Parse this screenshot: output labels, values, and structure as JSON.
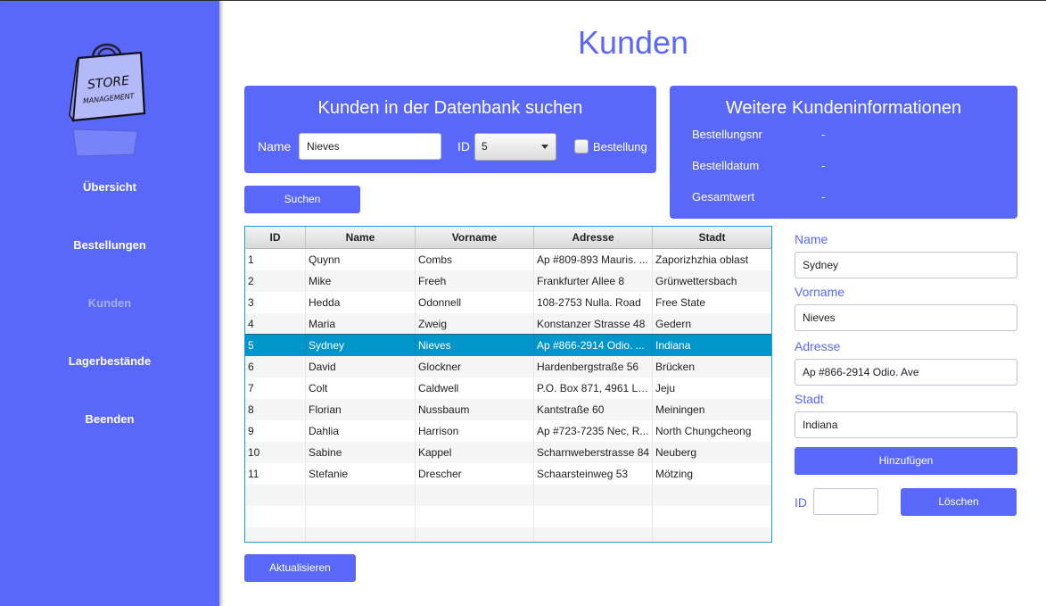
{
  "sidebar": {
    "logo_text_line1": "STORE",
    "logo_text_line2": "MANAGEMENT",
    "items": [
      {
        "label": "Übersicht"
      },
      {
        "label": "Bestellungen"
      },
      {
        "label": "Kunden"
      },
      {
        "label": "Lagerbestände"
      },
      {
        "label": "Beenden"
      }
    ],
    "active_index": 2
  },
  "page_title": "Kunden",
  "search": {
    "title": "Kunden in der Datenbank suchen",
    "name_label": "Name",
    "name_value": "Nieves",
    "id_label": "ID",
    "id_value": "5",
    "checkbox_label": "Bestellung",
    "checkbox_checked": false,
    "search_button": "Suchen"
  },
  "info": {
    "title": "Weitere Kundeninformationen",
    "rows": [
      {
        "label": "Bestellungsnr",
        "value": "-"
      },
      {
        "label": "Bestelldatum",
        "value": "-"
      },
      {
        "label": "Gesamtwert",
        "value": "-"
      }
    ]
  },
  "table": {
    "columns": [
      "ID",
      "Name",
      "Vorname",
      "Adresse",
      "Stadt"
    ],
    "rows": [
      [
        "1",
        "Quynn",
        "Combs",
        "Ap #809-893 Mauris. ...",
        "Zaporizhzhia oblast"
      ],
      [
        "2",
        "Mike",
        "Freeh",
        "Frankfurter Allee 8",
        "Grünwettersbach"
      ],
      [
        "3",
        "Hedda",
        "Odonnell",
        "108-2753 Nulla. Road",
        "Free State"
      ],
      [
        "4",
        "Maria",
        "Zweig",
        "Konstanzer Strasse 48",
        "Gedern"
      ],
      [
        "5",
        "Sydney",
        "Nieves",
        "Ap #866-2914 Odio. ...",
        "Indiana"
      ],
      [
        "6",
        "David",
        "Glockner",
        "Hardenbergstraße 56",
        "Brücken"
      ],
      [
        "7",
        "Colt",
        "Caldwell",
        "P.O. Box 871, 4961 Lu...",
        "Jeju"
      ],
      [
        "8",
        "Florian",
        "Nussbaum",
        "Kantstraße 60",
        "Meiningen"
      ],
      [
        "9",
        "Dahlia",
        "Harrison",
        "Ap #723-7235 Nec, R...",
        "North Chungcheong"
      ],
      [
        "10",
        "Sabine",
        "Kappel",
        "Scharnweberstrasse 84",
        "Neuberg"
      ],
      [
        "11",
        "Stefanie",
        "Drescher",
        "Schaarsteinweg 53",
        "Mötzing"
      ]
    ],
    "selected_row": 4
  },
  "refresh_button": "Aktualisieren",
  "form": {
    "name_label": "Name",
    "name_value": "Sydney",
    "vorname_label": "Vorname",
    "vorname_value": "Nieves",
    "adresse_label": "Adresse",
    "adresse_value": "Ap #866-2914 Odio. Ave",
    "stadt_label": "Stadt",
    "stadt_value": "Indiana",
    "add_button": "Hinzufügen",
    "id_label": "ID",
    "id_value": "",
    "delete_button": "Löschen"
  },
  "colors": {
    "accent": "#5a67fb",
    "selection": "#0096c9",
    "table_border": "#1b9fd6"
  }
}
